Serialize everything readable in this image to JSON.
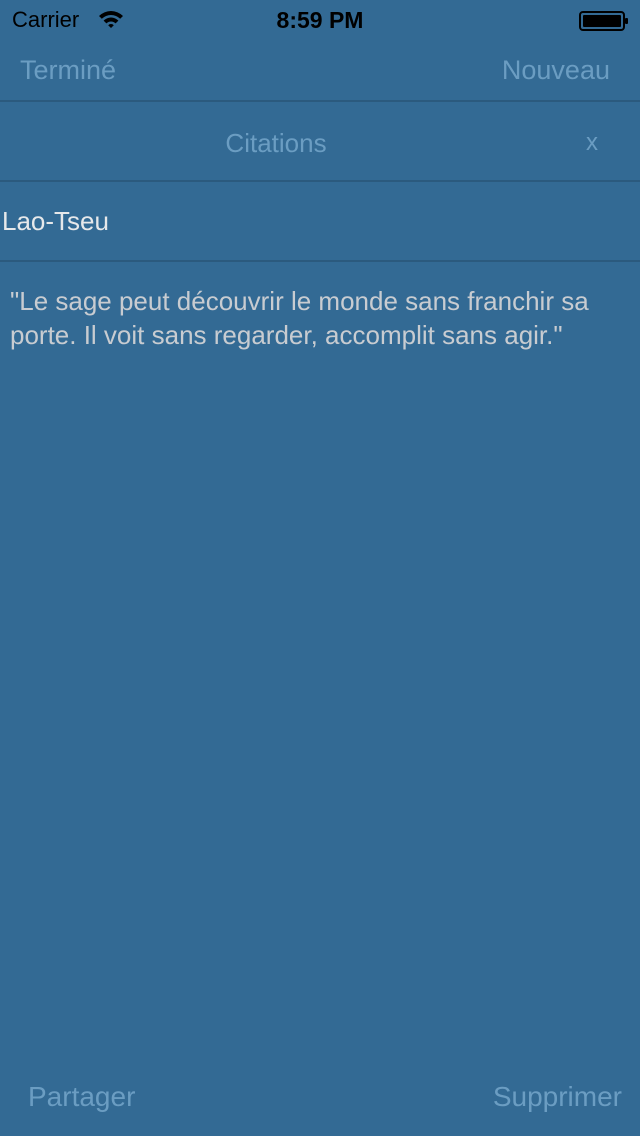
{
  "status_bar": {
    "carrier": "Carrier",
    "time": "8:59 PM",
    "wifi_icon": "wifi-icon",
    "battery_icon": "battery-icon"
  },
  "nav": {
    "done_label": "Terminé",
    "new_label": "Nouveau"
  },
  "header": {
    "title": "Citations",
    "close_label": "x"
  },
  "quote": {
    "author": "Lao-Tseu",
    "text": "\"Le sage peut découvrir le monde sans franchir sa porte. Il voit sans regarder, accomplit sans agir.\""
  },
  "toolbar": {
    "share_label": "Partager",
    "delete_label": "Supprimer"
  },
  "colors": {
    "background": "#336a94",
    "accent": "#6b9dc2",
    "separator": "#2b5a7e",
    "author_text": "#e6e8ea",
    "quote_text": "#c8ccd1"
  }
}
